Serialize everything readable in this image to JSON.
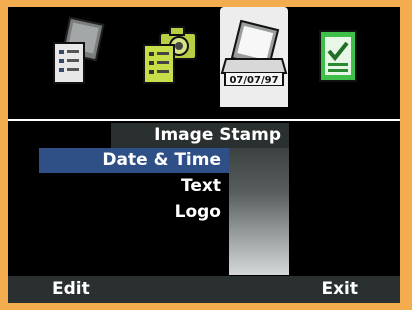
{
  "tabs": [
    {
      "icon": "playback-list-icon",
      "selected": false
    },
    {
      "icon": "camera-settings-icon",
      "selected": false
    },
    {
      "icon": "image-stamp-icon",
      "selected": true,
      "stamp_text": "07/07/97"
    },
    {
      "icon": "setup-checklist-icon",
      "selected": false
    }
  ],
  "menu": {
    "title": "Image Stamp",
    "items": [
      {
        "label": "Date & Time",
        "selected": true
      },
      {
        "label": "Text",
        "selected": false
      },
      {
        "label": "Logo",
        "selected": false
      }
    ]
  },
  "softkeys": {
    "left": "Edit",
    "right": "Exit"
  },
  "colors": {
    "bezel": "#f3ad4f",
    "highlight": "#2f4f87",
    "bar": "#2a2f2f"
  }
}
